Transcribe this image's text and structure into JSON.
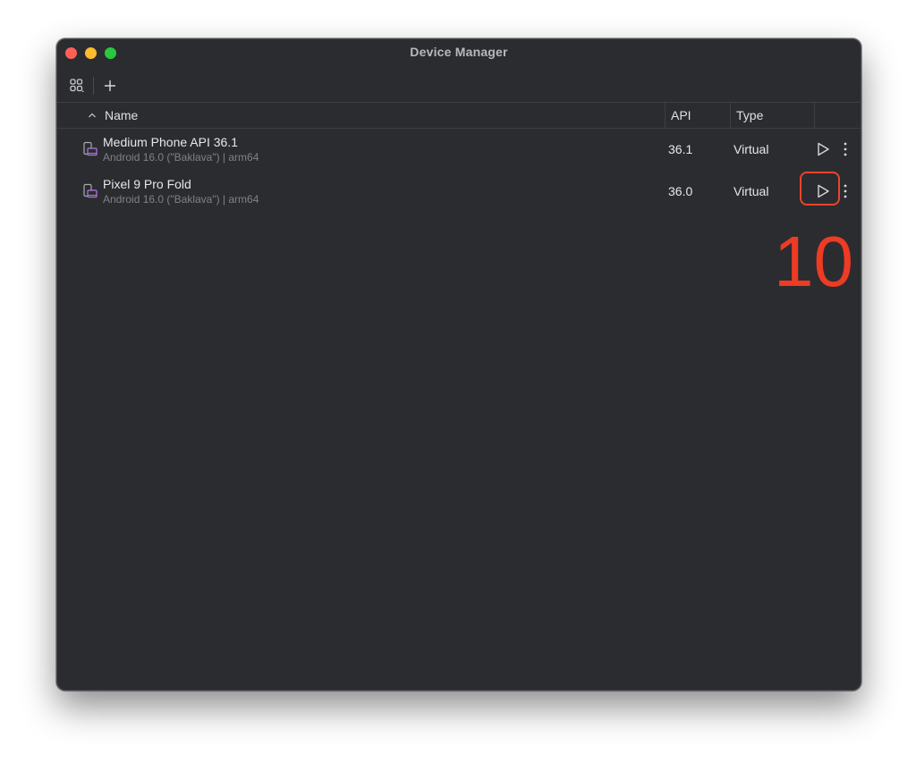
{
  "window": {
    "title": "Device Manager"
  },
  "toolbar": {
    "group_icon": "grid-group-icon",
    "add_icon": "plus-icon"
  },
  "table": {
    "columns": {
      "name": "Name",
      "api": "API",
      "type": "Type"
    },
    "sort_icon": "chevron-up-icon",
    "rows": [
      {
        "name": "Medium Phone API 36.1",
        "subtitle": "Android 16.0 (\"Baklava\") | arm64",
        "api": "36.1",
        "type": "Virtual",
        "icon": "virtual-device-icon"
      },
      {
        "name": "Pixel 9 Pro Fold",
        "subtitle": "Android 16.0 (\"Baklava\") | arm64",
        "api": "36.0",
        "type": "Virtual",
        "icon": "virtual-device-icon"
      }
    ]
  },
  "annotation": {
    "step_number": "10",
    "color": "#ee3b24"
  },
  "colors": {
    "window_bg": "#2b2c30",
    "text_primary": "#e6e7ea",
    "text_secondary": "#7f8186",
    "device_icon_accent": "#b07ae0"
  }
}
